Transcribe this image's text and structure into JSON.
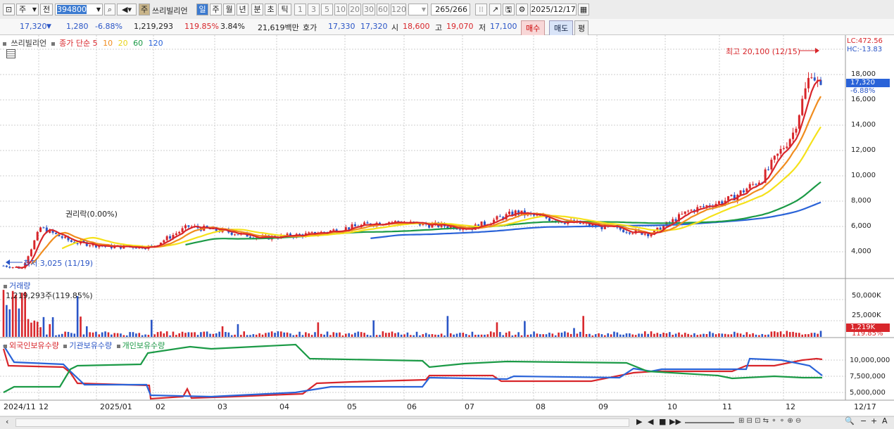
{
  "toolbar": {
    "market": "주",
    "prev": "전",
    "code": "394800",
    "type_badge": "주",
    "stock_name": "쓰리빌리언",
    "periods": [
      "일",
      "주",
      "월",
      "년",
      "분",
      "초",
      "틱"
    ],
    "intervals": [
      "1",
      "3",
      "5",
      "10",
      "20",
      "30",
      "60",
      "120"
    ],
    "count": "265",
    "count_total": "/266",
    "date": "2025/12/17"
  },
  "price_row": {
    "price": "17,320",
    "change": "1,280",
    "change_pct": "-6.88%",
    "volume": "1,219,293",
    "vol_ratio": "119.85%",
    "turnover": "3.84%",
    "amount": "21,619백만",
    "ask_label": "호가",
    "ask": "17,330",
    "bid": "17,320",
    "open_label": "시",
    "open": "18,600",
    "high_label": "고",
    "high": "19,070",
    "low_label": "저",
    "low": "17,100",
    "buy_label": "매수",
    "sell_label": "매도",
    "eval_label": "평"
  },
  "legend": {
    "name": "쓰리빌리언",
    "series": "종가 단순",
    "ma": [
      "5",
      "10",
      "20",
      "60",
      "120"
    ],
    "colors": [
      "#d8262b",
      "#f08c1e",
      "#f5e11a",
      "#1b9a46",
      "#2a63d8"
    ]
  },
  "price_chart": {
    "lc": "LC:472.56",
    "hc": "HC:-13.83",
    "high_note": "최고 20,100 (12/15)",
    "low_note": "최저 3,025 (11/19)",
    "rights_note": "권리락(0.00%)",
    "last_price": "17,320",
    "last_pct": "-6.88%",
    "y_ticks": [
      "18,000",
      "16,000",
      "14,000",
      "12,000",
      "10,000",
      "8,000",
      "6,000",
      "4,000"
    ]
  },
  "volume_chart": {
    "title": "거래량",
    "info": "1,219,293주(119.85%)",
    "y_ticks": [
      "50,000K",
      "25,000K"
    ],
    "last": "1,219K",
    "last_pct": "119.85%"
  },
  "holding_chart": {
    "s1": "외국인보유수량",
    "s2": "기관보유수량",
    "s3": "개인보유수량",
    "y_ticks": [
      "10,000,000",
      "7,500,000",
      "5,000,000"
    ]
  },
  "x_axis": [
    "2024/11",
    "12",
    "2025/01",
    "02",
    "03",
    "04",
    "05",
    "06",
    "07",
    "08",
    "09",
    "10",
    "11",
    "12"
  ],
  "x_end": "12/17"
}
